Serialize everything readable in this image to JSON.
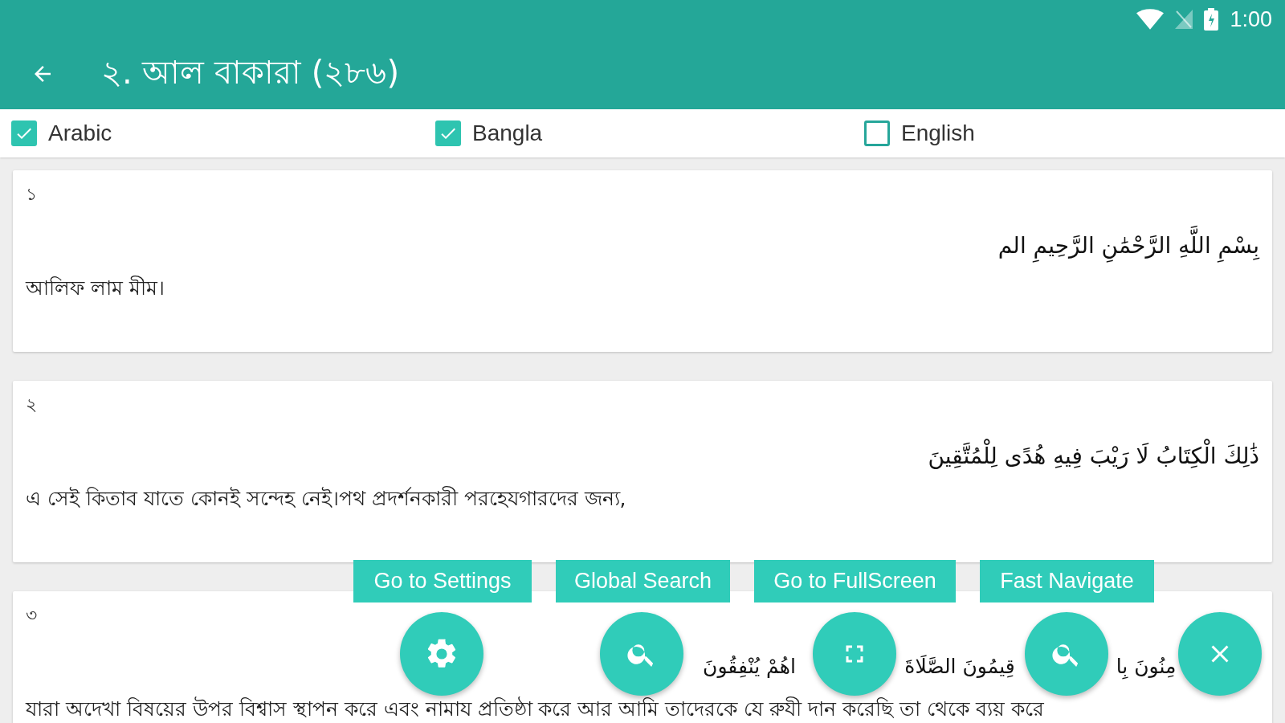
{
  "status_bar": {
    "time": "1:00"
  },
  "app_bar": {
    "title": "২. আল বাকারা (২৮৬)"
  },
  "language_options": [
    {
      "label": "Arabic",
      "checked": true
    },
    {
      "label": "Bangla",
      "checked": true
    },
    {
      "label": "English",
      "checked": false
    }
  ],
  "verses": [
    {
      "number": "১",
      "arabic": [
        "بِسْمِ اللَّهِ الرَّحْمَٰنِ الرَّحِيمِ الم"
      ],
      "bangla": "আলিফ লাম মীম।"
    },
    {
      "number": "২",
      "arabic": [
        "ذَٰلِكَ الْكِتَابُ لَا رَيْبَ فِيهِ هُدًى لِلْمُتَّقِينَ"
      ],
      "bangla": "এ সেই কিতাব যাতে কোনই সন্দেহ নেই।পথ প্রদর্শনকারী পরহেযগারদের জন্য,"
    },
    {
      "number": "৩",
      "arabic": [
        "مِنُونَ بِا",
        "قِيمُونَ الصَّلَاةَ",
        "اهُمْ يُنْفِقُونَ"
      ],
      "bangla": "যারা অদেখা বিষয়ের উপর বিশ্বাস স্থাপন করে এবং নামায প্রতিষ্ঠা করে আর আমি তাদেরকে যে রুযী দান করেছি তা থেকে ব্যয় করে"
    }
  ],
  "fab_menu": {
    "actions": [
      {
        "label": "Go to Settings"
      },
      {
        "label": "Global Search"
      },
      {
        "label": "Go to FullScreen"
      },
      {
        "label": "Fast Navigate"
      }
    ]
  }
}
